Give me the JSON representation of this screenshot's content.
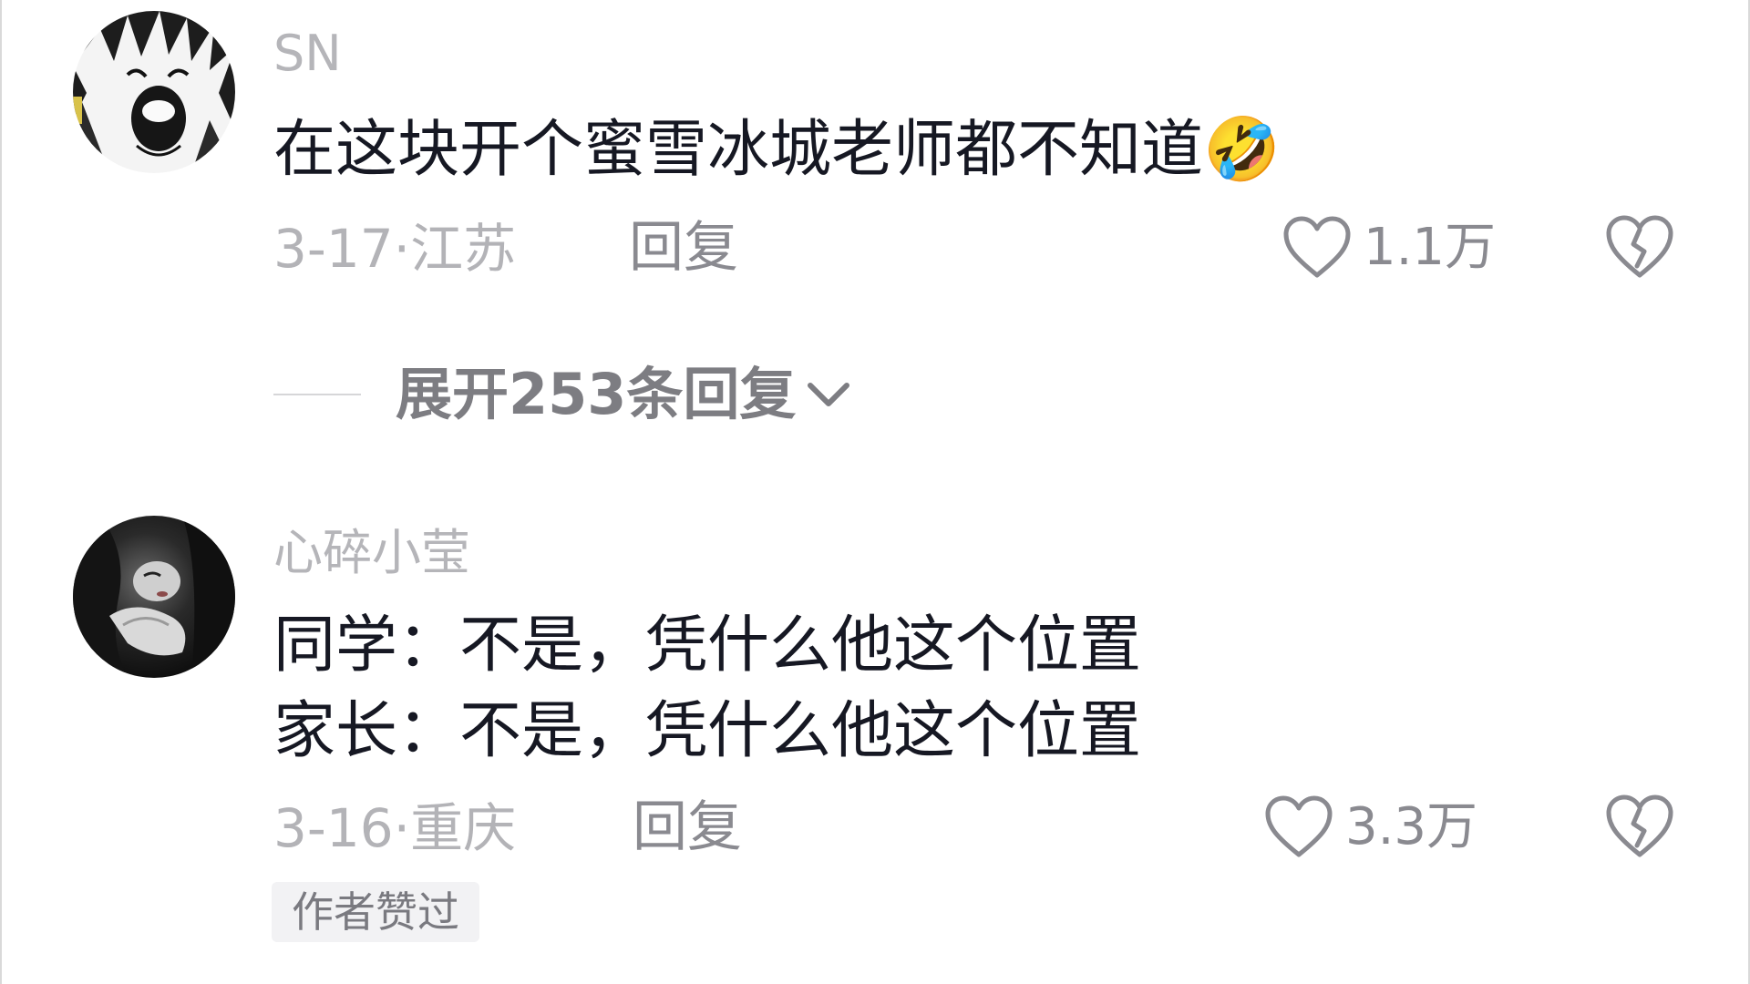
{
  "comments": [
    {
      "username": "SN",
      "text_lines": [
        "在这块开个蜜雪冰城老师都不知道🤣"
      ],
      "date": "3-17",
      "location": "江苏",
      "reply_label": "回复",
      "likes": "1.1万",
      "avatar_icon": "anime-screaming-avatar"
    },
    {
      "username": "心碎小莹",
      "text_lines": [
        "同学：不是，凭什么他这个位置",
        "家长：不是，凭什么他这个位置"
      ],
      "date": "3-16",
      "location": "重庆",
      "reply_label": "回复",
      "likes": "3.3万",
      "badge": "作者赞过",
      "avatar_icon": "dark-photo-avatar"
    }
  ],
  "expand_replies": {
    "label": "展开253条回复"
  },
  "colors": {
    "username": "#b5b5b9",
    "text": "#161823",
    "meta": "#b3b3b7",
    "action": "#8a8a90"
  },
  "meta_separator": "·"
}
